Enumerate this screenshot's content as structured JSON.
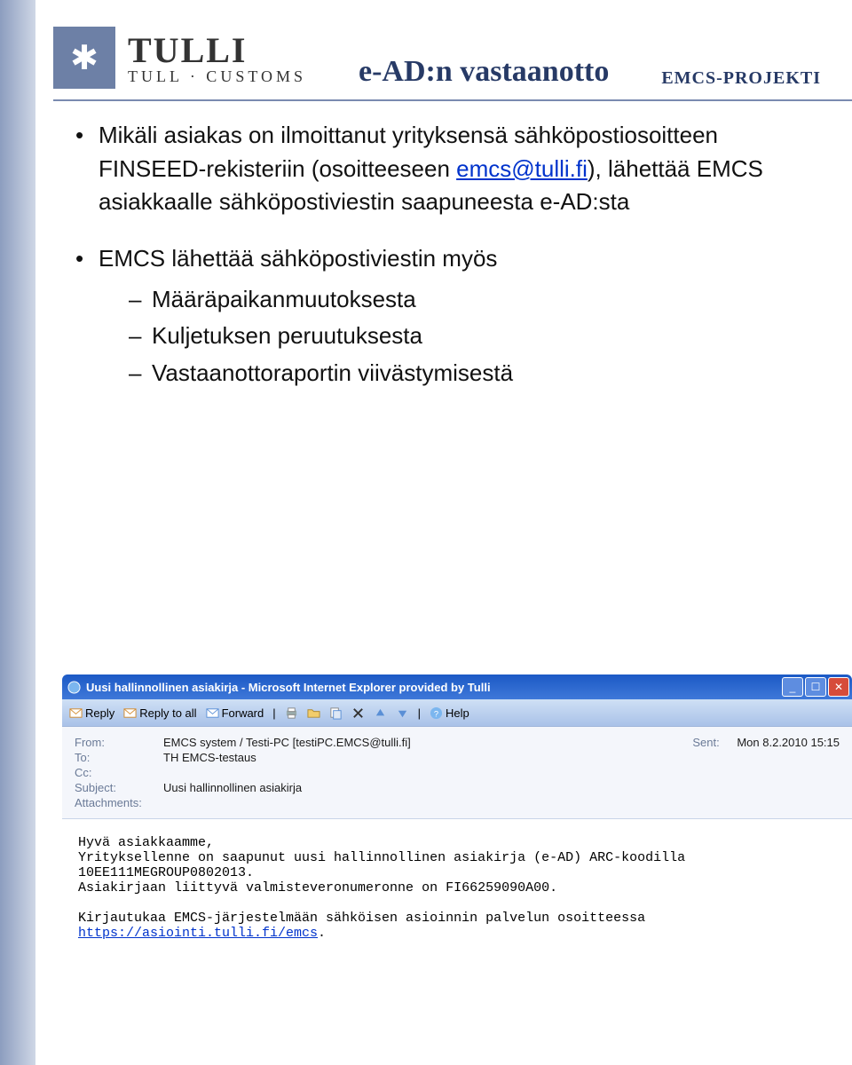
{
  "org": {
    "name": "Tulli",
    "subtitle": "Tull · Customs",
    "project": "EMCS-PROJEKTI"
  },
  "slide_title": "e-AD:n vastaanotto",
  "bullets": {
    "b1_pre": "Mikäli asiakas on ilmoittanut yrityksensä sähköpostiosoitteen FINSEED-rekisteriin (osoitteeseen ",
    "b1_link": "emcs@tulli.fi",
    "b1_post": "), lähettää EMCS asiakkaalle sähköpostiviestin saapuneesta e-AD:sta",
    "b2": "EMCS lähettää sähköpostiviestin myös",
    "b2_subs": [
      "Määräpaikanmuutoksesta",
      "Kuljetuksen peruutuksesta",
      "Vastaanottoraportin viivästymisestä"
    ]
  },
  "email": {
    "window_title": "Uusi hallinnollinen asiakirja - Microsoft Internet Explorer provided by Tulli",
    "toolbar": {
      "reply": "Reply",
      "reply_all": "Reply to all",
      "forward": "Forward",
      "help": "Help"
    },
    "icons": {
      "ie": "ie-icon",
      "env": "envelope-icon",
      "print": "print-icon",
      "folder": "folder-icon",
      "copy": "copy-icon",
      "delete": "delete-icon",
      "up": "arrow-up-icon",
      "down": "arrow-down-icon",
      "help": "help-icon"
    },
    "headers": {
      "from_label": "From:",
      "from": "EMCS system / Testi-PC [testiPC.EMCS@tulli.fi]",
      "sent_label": "Sent:",
      "sent": "Mon 8.2.2010 15:15",
      "to_label": "To:",
      "to": "TH EMCS-testaus",
      "cc_label": "Cc:",
      "cc": "",
      "subject_label": "Subject:",
      "subject": "Uusi hallinnollinen asiakirja",
      "att_label": "Attachments:",
      "att": ""
    },
    "body": {
      "greeting": "Hyvä asiakkaamme,",
      "l1": "Yrityksellenne on saapunut uusi hallinnollinen asiakirja (e-AD) ARC-koodilla",
      "l2": "10EE111MEGROUP0802013.",
      "l3": "Asiakirjaan liittyvä valmisteveronumeronne on FI66259090A00.",
      "l4": "Kirjautukaa EMCS-järjestelmään sähköisen asioinnin palvelun osoitteessa",
      "url": "https://asiointi.tulli.fi/emcs"
    }
  }
}
